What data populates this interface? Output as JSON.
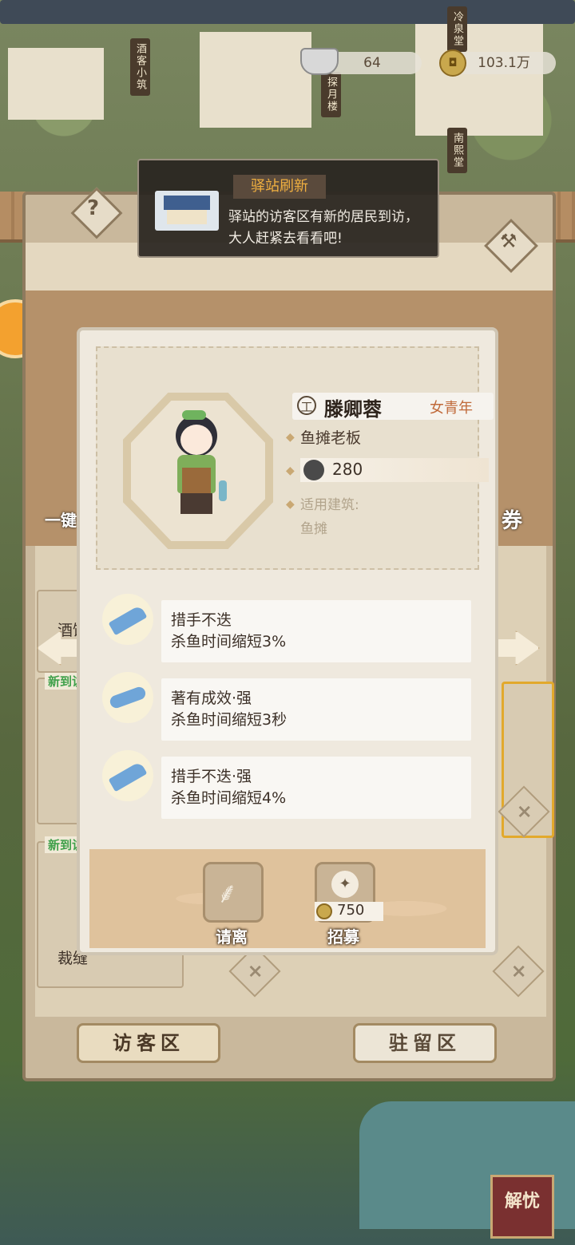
{
  "town": {
    "signs": [
      "酒客小筑",
      "探月楼",
      "冷泉堂",
      "南熙堂"
    ]
  },
  "resources": {
    "silver": {
      "icon": "silver-ingot-icon",
      "value": "64"
    },
    "coins": {
      "icon": "copper-coin-icon",
      "value": "103.1万"
    }
  },
  "notice": {
    "title": "驿站刷新",
    "text": "驿站的访客区有新的居民到访，大人赶紧去看看吧!"
  },
  "panel": {
    "help_label": "?",
    "behind_left_label": "一键",
    "behind_right_label": "券",
    "behind_slot1_label": "酒馆",
    "behind_slot2_label": "裁缝",
    "new_badge": "新到访",
    "tabs": [
      "访客区",
      "驻留区"
    ]
  },
  "character": {
    "grade": "工",
    "name": "滕卿蓉",
    "age_group": "女青年",
    "occupation": "鱼摊老板",
    "power": "280",
    "building_label": "适用建筑:",
    "building": "鱼摊"
  },
  "skills": [
    {
      "icon": "cleaver-icon",
      "title": "措手不迭",
      "desc": "杀鱼时间缩短3%"
    },
    {
      "icon": "fish-knife-icon",
      "title": "著有成效·强",
      "desc": "杀鱼时间缩短3秒"
    },
    {
      "icon": "cleaver-icon",
      "title": "措手不迭·强",
      "desc": "杀鱼时间缩短4%"
    }
  ],
  "actions": {
    "dismiss_label": "请离",
    "recruit_label": "招募",
    "recruit_cost": "750"
  },
  "bottom_right": {
    "label": "解忧"
  },
  "colors": {
    "accent": "#f0b040",
    "panel": "#c9b89c",
    "card": "#efe9de"
  }
}
